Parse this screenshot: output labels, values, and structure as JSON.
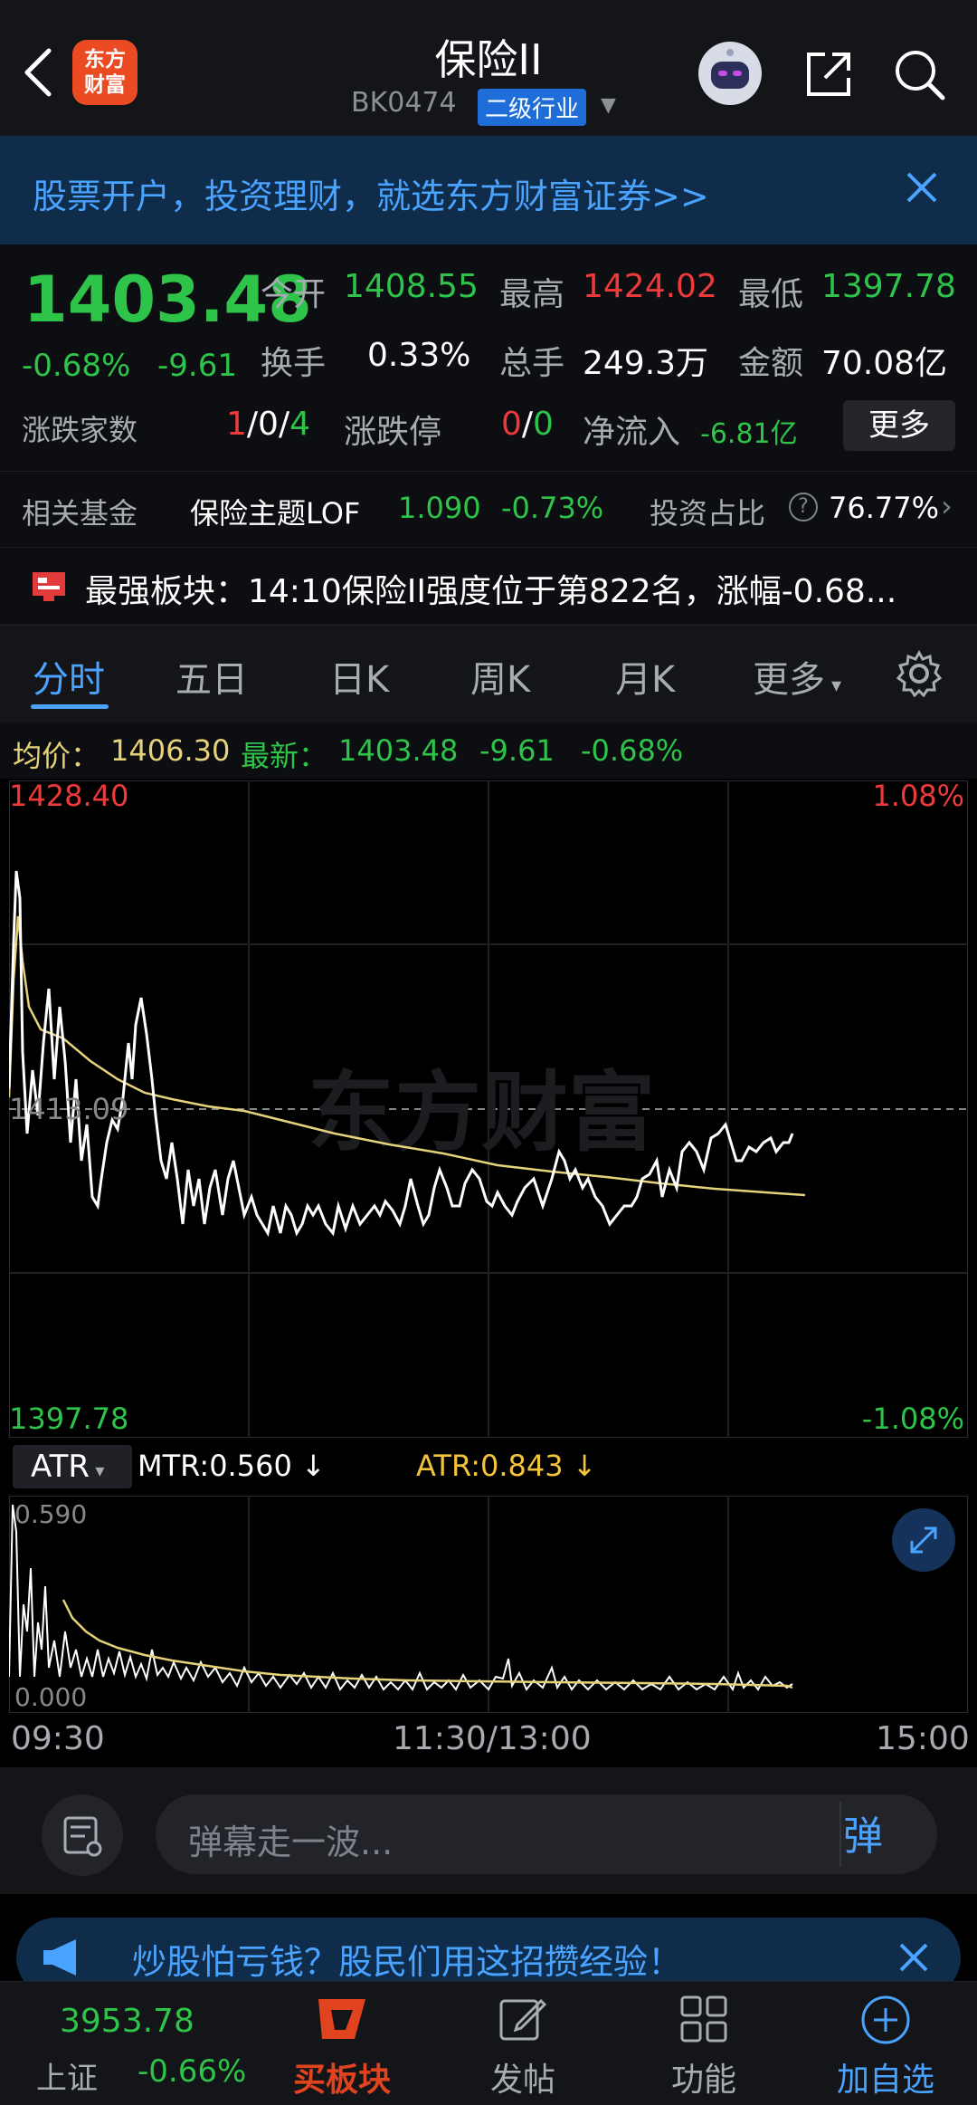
{
  "header": {
    "logo_text": "东方财富",
    "title": "保险II",
    "code": "BK0474",
    "tag": "二级行业",
    "icons": [
      "back-arrow-icon",
      "robot-icon",
      "share-icon",
      "search-icon"
    ]
  },
  "banner": {
    "text": "股票开户，投资理财，就选东方财富证券>>"
  },
  "quote": {
    "price": "1403.48",
    "change_pct": "-0.68%",
    "change_abs": "-9.61",
    "open_label": "今开",
    "open": "1408.55",
    "high_label": "最高",
    "high": "1424.02",
    "low_label": "最低",
    "low": "1397.78",
    "turnover_label": "换手",
    "turnover": "0.33%",
    "volume_label": "总手",
    "volume": "249.3万",
    "amount_label": "金额",
    "amount": "70.08亿",
    "updown_label": "涨跌家数",
    "up": "1",
    "flat": "0",
    "down": "4",
    "limit_label": "涨跌停",
    "limit_up": "0",
    "limit_down": "0",
    "netflow_label": "净流入",
    "netflow": "-6.81亿",
    "more_button": "更多"
  },
  "fund": {
    "label": "相关基金",
    "name": "保险主题LOF",
    "price": "1.090",
    "change": "-0.73%",
    "ratio_label": "投资占比",
    "ratio": "76.77%"
  },
  "strong": {
    "text": "最强板块：14:10保险II强度位于第822名，涨幅-0.68..."
  },
  "tabs": [
    "分时",
    "五日",
    "日K",
    "周K",
    "月K",
    "更多"
  ],
  "info": {
    "avg_label": "均价：",
    "avg": "1406.30",
    "latest_label": "最新：",
    "latest": "1403.48",
    "chg": "-9.61",
    "pct": "-0.68%"
  },
  "chart_labels": {
    "top_left": "1428.40",
    "top_right": "1.08%",
    "mid": "1413.09",
    "bottom_left": "1397.78",
    "bottom_right": "-1.08%",
    "watermark": "东方财富"
  },
  "atr": {
    "select": "ATR",
    "mtr": "MTR:0.560",
    "atr": "ATR:0.843",
    "top": "0.590",
    "bottom": "0.000"
  },
  "times": [
    "09:30",
    "11:30/13:00",
    "15:00"
  ],
  "danmu": {
    "placeholder": "弹幕走一波...",
    "button": "弹"
  },
  "promo": {
    "text": "炒股怕亏钱？股民们用这招攒经验！"
  },
  "nav": {
    "index_value": "3953.78",
    "index_name": "上证",
    "index_change": "-0.66%",
    "items": [
      "买板块",
      "发帖",
      "功能",
      "加自选"
    ]
  },
  "colors": {
    "up": "#ee3a3a",
    "down": "#2ec44a",
    "accent": "#4aa3ff",
    "avg_line": "#e6d27a"
  }
}
